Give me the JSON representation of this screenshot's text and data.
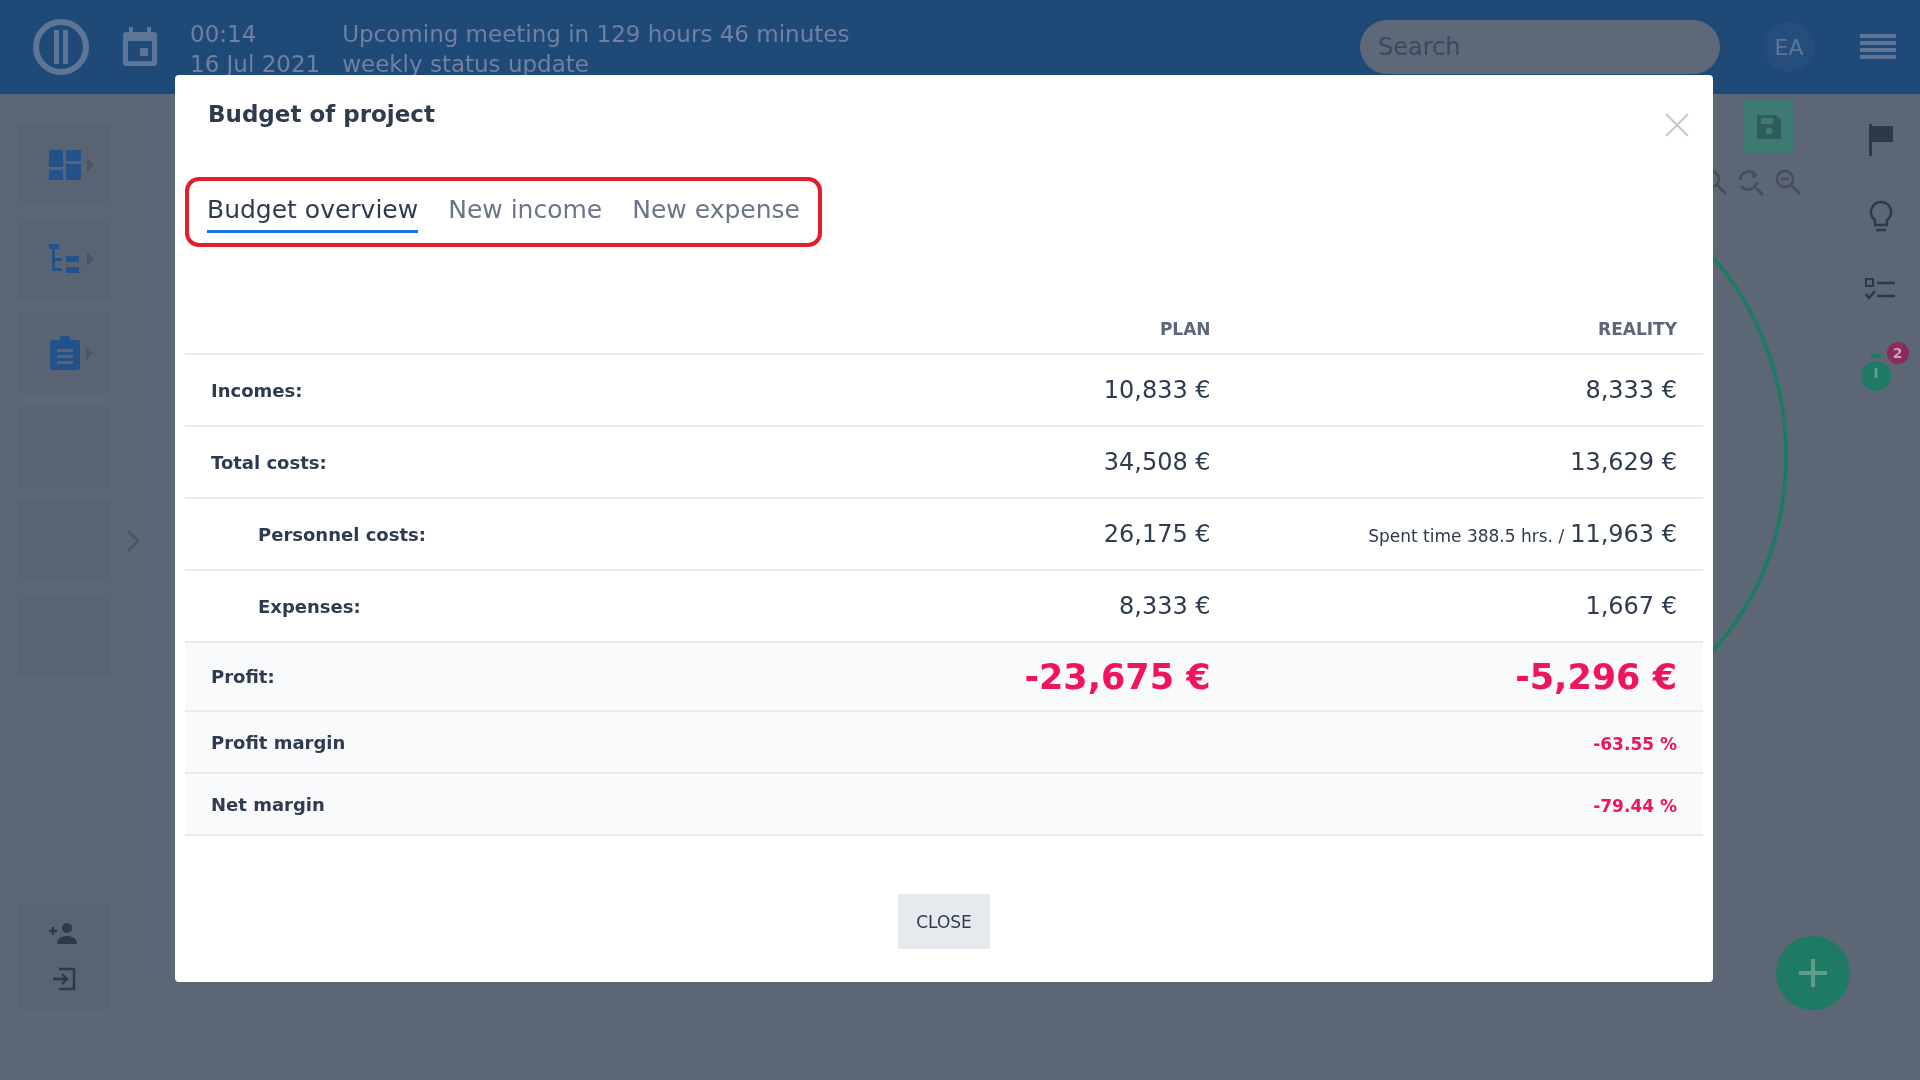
{
  "top_bar": {
    "time": "00:14",
    "meeting": "Upcoming meeting in 129 hours 46 minutes",
    "date": "16 Jul 2021",
    "meeting_title": "weekly status update",
    "search": {
      "placeholder": "Search"
    },
    "avatar": "EA"
  },
  "right_sidebar": {
    "timer_badge": "2"
  },
  "modal": {
    "title": "Budget of project",
    "tabs": [
      {
        "label": "Budget overview",
        "selected": true
      },
      {
        "label": "New income",
        "selected": false
      },
      {
        "label": "New expense",
        "selected": false
      }
    ],
    "columns": [
      "PLAN",
      "REALITY"
    ],
    "rows": [
      {
        "kind": "main",
        "label": "Incomes:",
        "plan": "10,833 €",
        "reality": "8,333 €"
      },
      {
        "kind": "main",
        "label": "Total costs:",
        "plan": "34,508 €",
        "reality": "13,629 €"
      },
      {
        "kind": "sub",
        "label": "Personnel costs:",
        "plan": "26,175 €",
        "reality_note": "Spent time 388.5 hrs. /",
        "reality": "11,963 €"
      },
      {
        "kind": "sub",
        "label": "Expenses:",
        "plan": "8,333 €",
        "reality": "1,667 €"
      },
      {
        "kind": "profit",
        "label": "Profit:",
        "plan": "-23,675 €",
        "reality": "-5,296 €"
      },
      {
        "kind": "margin",
        "label": "Profit margin",
        "reality": "-63.55 %"
      },
      {
        "kind": "margin",
        "label": "Net margin",
        "reality": "-79.44 %"
      }
    ],
    "close_button": "CLOSE"
  }
}
